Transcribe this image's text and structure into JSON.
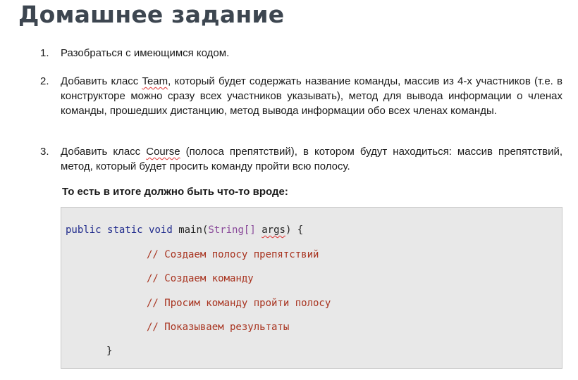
{
  "title": "Домашнее задание",
  "items": [
    {
      "number": "1.",
      "text": "Разобраться с имеющимся кодом."
    },
    {
      "number": "2.",
      "text_pre": "Добавить класс ",
      "term": "Team",
      "text_post": ", который будет содержать название команды, массив из 4-х участников (т.е. в конструкторе можно сразу всех участников указывать), метод для вывода информации о членах команды, прошедших дистанцию, метод вывода информации обо всех членах команды."
    },
    {
      "number": "3.",
      "text_pre": "Добавить класс ",
      "term": "Course",
      "text_post": " (полоса препятствий), в котором будут находиться: массив препятствий, метод, который будет просить команду пройти всю полосу."
    }
  ],
  "note": "То есть в итоге должно быть что-то вроде:",
  "code": {
    "kw_public": "public",
    "kw_static": "static",
    "kw_void": "void",
    "method": "main(",
    "type": "String[]",
    "param": "args",
    "open": ") {",
    "comments": [
      "// Создаем полосу препятствий",
      "// Создаем команду",
      "// Просим команду пройти полосу",
      "// Показываем результаты"
    ],
    "close": "}"
  }
}
